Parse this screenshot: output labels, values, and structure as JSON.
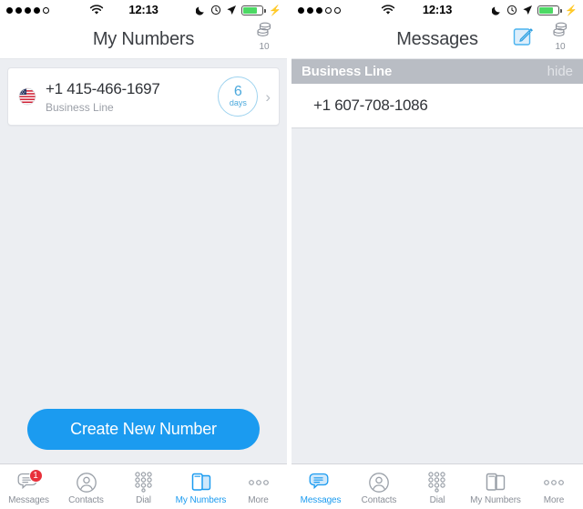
{
  "screens": [
    {
      "id": "my-numbers",
      "status": {
        "signal_filled": 4,
        "signal_total": 5,
        "wifi_icon": "wifi-icon",
        "time": "12:13",
        "dnd_icon": "moon-icon",
        "alarm_icon": "alarm-icon",
        "location_icon": "location-arrow-icon",
        "battery_icon": "battery-icon",
        "charging_icon": "lightning-bolt-icon",
        "battery_level": 72
      },
      "nav": {
        "title": "My Numbers",
        "credits_icon": "coins-stack-icon",
        "credits_count": "10"
      },
      "card": {
        "flag_icon": "us-flag-icon",
        "number": "+1 415-466-1697",
        "label": "Business Line",
        "days_value": "6",
        "days_unit": "days",
        "chevron_icon": "chevron-right-icon"
      },
      "cta_label": "Create New Number",
      "tabs": [
        {
          "label": "Messages",
          "icon": "messages-bubble-icon",
          "active": false,
          "badge": "1"
        },
        {
          "label": "Contacts",
          "icon": "contacts-person-icon",
          "active": false,
          "badge": ""
        },
        {
          "label": "Dial",
          "icon": "dial-keypad-icon",
          "active": false,
          "badge": ""
        },
        {
          "label": "My Numbers",
          "icon": "my-numbers-phones-icon",
          "active": true,
          "badge": ""
        },
        {
          "label": "More",
          "icon": "more-ellipsis-icon",
          "active": false,
          "badge": ""
        }
      ]
    },
    {
      "id": "messages",
      "status": {
        "signal_filled": 3,
        "signal_total": 5,
        "wifi_icon": "wifi-icon",
        "time": "12:13",
        "dnd_icon": "moon-icon",
        "alarm_icon": "alarm-icon",
        "location_icon": "location-arrow-icon",
        "battery_icon": "battery-icon",
        "charging_icon": "lightning-bolt-icon",
        "battery_level": 72
      },
      "nav": {
        "title": "Messages",
        "compose_icon": "compose-pencil-icon",
        "credits_icon": "coins-stack-icon",
        "credits_count": "10"
      },
      "section": {
        "title": "Business Line",
        "hide_label": "hide"
      },
      "rows": [
        {
          "number": "+1 607-708-1086"
        }
      ],
      "tabs": [
        {
          "label": "Messages",
          "icon": "messages-bubble-icon",
          "active": true,
          "badge": ""
        },
        {
          "label": "Contacts",
          "icon": "contacts-person-icon",
          "active": false,
          "badge": ""
        },
        {
          "label": "Dial",
          "icon": "dial-keypad-icon",
          "active": false,
          "badge": ""
        },
        {
          "label": "My Numbers",
          "icon": "my-numbers-phones-icon",
          "active": false,
          "badge": ""
        },
        {
          "label": "More",
          "icon": "more-ellipsis-icon",
          "active": false,
          "badge": ""
        }
      ]
    }
  ],
  "colors": {
    "accent_blue": "#1b9bf0",
    "badge_red": "#e8303a",
    "section_gray": "#b9bdc4",
    "page_bg": "#eceef2",
    "battery_green": "#4cd964",
    "days_circle_blue": "#4aa8dc"
  }
}
